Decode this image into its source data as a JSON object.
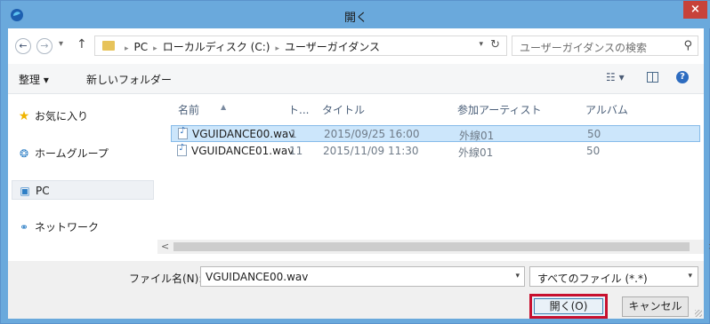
{
  "window": {
    "title": "開く",
    "close_label": "×"
  },
  "nav_buttons": {
    "back": "←",
    "forward": "→",
    "recent": "▾",
    "up": "↑"
  },
  "address": {
    "crumbs": [
      "PC",
      "ローカルディスク (C:)",
      "ユーザーガイダンス"
    ],
    "separator": "▸",
    "dropdown": "▾",
    "refresh": "↻"
  },
  "search": {
    "placeholder": "ユーザーガイダンスの検索",
    "icon": "⚲"
  },
  "toolbar": {
    "organize_label": "整理 ▾",
    "new_folder_label": "新しいフォルダー",
    "view_label": "☷ ▾",
    "help_label": "?"
  },
  "sidebar": {
    "items": [
      {
        "label": "お気に入り",
        "icon": "★"
      },
      {
        "label": "ホームグループ",
        "icon": "❂"
      },
      {
        "label": "PC",
        "icon": "▣"
      },
      {
        "label": "ネットワーク",
        "icon": "⚭"
      }
    ]
  },
  "columns": [
    "名前",
    "ト...",
    "タイトル",
    "参加アーティスト",
    "アルバム"
  ],
  "files": [
    {
      "name": "VGUIDANCE00.wav",
      "track": "1",
      "title": "2015/09/25 16:00",
      "artist": "外線01",
      "album": "50"
    },
    {
      "name": "VGUIDANCE01.wav",
      "track": "11",
      "title": "2015/11/09 11:30",
      "artist": "外線01",
      "album": "50"
    }
  ],
  "scroll": {
    "left": "<",
    "right": ">"
  },
  "bottom": {
    "filename_label": "ファイル名(N):",
    "filename_value": "VGUIDANCE00.wav",
    "filetype_value": "すべてのファイル (*.*)",
    "open_label": "開く(O)",
    "cancel_label": "キャンセル"
  },
  "colors": {
    "titlebar": "#6aa9dc",
    "selection": "#cce6fb",
    "highlight_border": "#c8102e",
    "close": "#c7423a"
  }
}
